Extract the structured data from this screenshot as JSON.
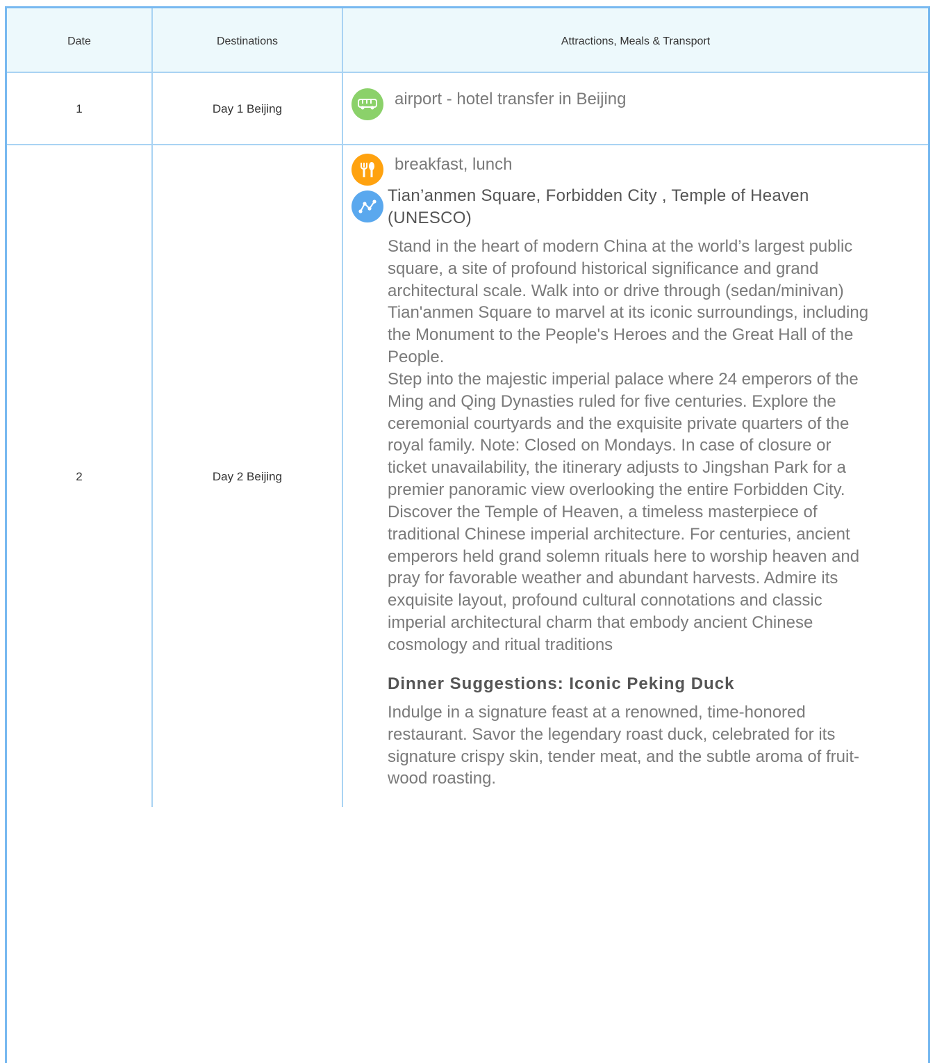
{
  "table": {
    "headers": {
      "date": "Date",
      "destinations": "Destinations",
      "details": "Attractions, Meals & Transport"
    },
    "rows": [
      {
        "date": "1",
        "destination": "Day 1 Beijing",
        "transport": "airport - hotel transfer in Beijing"
      },
      {
        "date": "2",
        "destination": "Day 2 Beijing",
        "meals": "breakfast, lunch",
        "attractions_title": "Tian’anmen Square, Forbidden City , Temple of Heaven (UNESCO)",
        "paragraph_1": "Stand in the heart of modern China at the world’s largest public square, a site of profound historical significance and grand architectural scale. Walk into or drive through (sedan/minivan) Tian'anmen Square to marvel at its iconic surroundings, including the Monument to the People's Heroes and the Great Hall of the People.",
        "paragraph_2": "Step into the majestic imperial palace where 24 emperors of the Ming and Qing Dynasties ruled for five centuries. Explore the ceremonial courtyards and the exquisite private quarters of the royal family. Note: Closed on Mondays. In case of closure or ticket unavailability, the itinerary adjusts to Jingshan Park for a premier panoramic view overlooking the entire Forbidden City.",
        "paragraph_3": "Discover the Temple of Heaven, a timeless masterpiece of traditional Chinese imperial architecture. For centuries, ancient emperors held grand solemn rituals here to worship heaven and pray for favorable weather and abundant harvests. Admire its exquisite layout, profound cultural connotations and classic imperial architectural charm that embody ancient Chinese cosmology and ritual traditions",
        "dinner_title": "Dinner Suggestions: Iconic Peking Duck",
        "dinner_text": "Indulge in a signature feast at a renowned, time-honored restaurant. Savor the legendary roast duck, celebrated for its signature crispy skin, tender meat, and the subtle aroma of fruit-wood roasting."
      }
    ]
  },
  "icons": {
    "transport": "bus-icon",
    "meals": "fork-spoon-icon",
    "attractions": "route-icon"
  },
  "colors": {
    "border": "#78b9f0",
    "grid": "#a9d3f3",
    "header_bg": "#edf9fc",
    "transport_icon": "#8bd16a",
    "meals_icon": "#ffa20f",
    "attractions_icon": "#5aa8ee"
  }
}
